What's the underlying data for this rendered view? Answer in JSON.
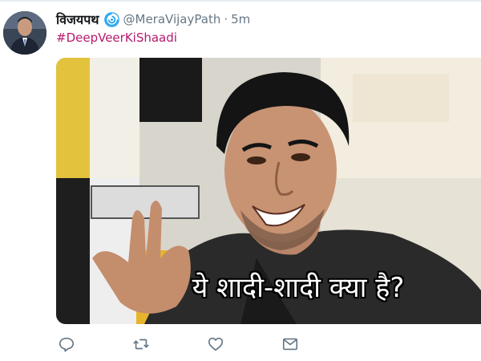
{
  "tweet": {
    "display_name": "विजयपथ",
    "handle": "@MeraVijayPath",
    "separator": "·",
    "time": "5m",
    "hashtag": "#DeepVeerKiShaadi",
    "media": {
      "caption": "ये शादी-शादी क्या है?"
    },
    "actions": [
      "reply-icon",
      "retweet-icon",
      "like-icon",
      "message-icon"
    ]
  },
  "colors": {
    "hashtag": "#b6196e",
    "secondary_text": "#657786",
    "verified": "#1da1f2",
    "icon": "#657786"
  }
}
